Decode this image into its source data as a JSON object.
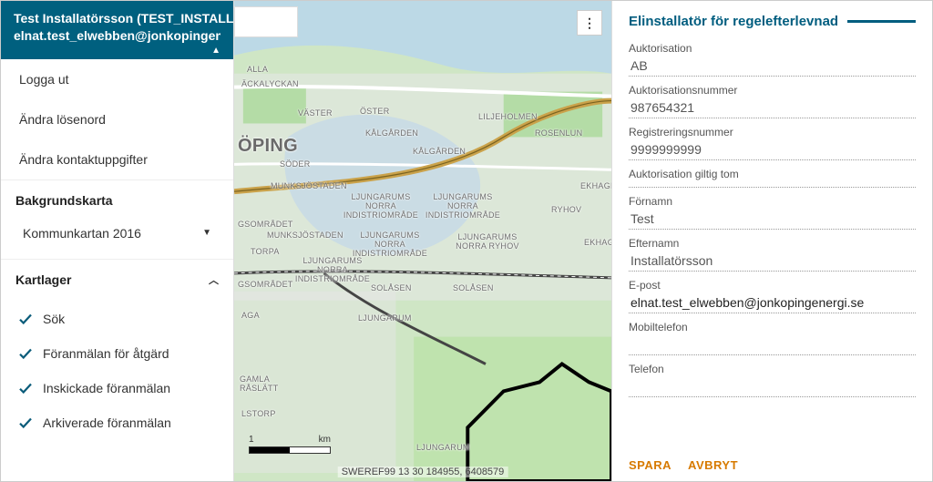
{
  "sidebar": {
    "user_name": "Test Installatörsson (TEST_INSTALLER)",
    "user_email": "elnat.test_elwebben@jonkopingenergi",
    "menu": {
      "logout": "Logga ut",
      "change_password": "Ändra lösenord",
      "change_contact": "Ändra kontaktuppgifter"
    },
    "basemap_title": "Bakgrundskarta",
    "basemap_selected": "Kommunkartan 2016",
    "layers_title": "Kartlager",
    "layers": [
      {
        "label": "Sök"
      },
      {
        "label": "Föranmälan för åtgärd"
      },
      {
        "label": "Inskickade föranmälan"
      },
      {
        "label": "Arkiverade föranmälan"
      }
    ]
  },
  "map": {
    "city_label": "ÖPING",
    "scale_label": "km",
    "scale_value": "1",
    "footer": "SWEREF99 13 30 184955, 6408579",
    "districts": [
      "ALLA",
      "ÄCKALYCKAN",
      "VÄSTER",
      "ÖSTER",
      "KÅLGÅRDEN",
      "LILJEHOLMEN",
      "ROSENLUN",
      "KÅLGÅRDEN",
      "SÖDER",
      "MUNKSJÖSTADEN",
      "LJUNGARUMS NORRA INDISTRIOMRÅDE",
      "LJUNGARUMS NORRA INDISTRIOMRÅDE",
      "RYHOV",
      "EKHAGE",
      "GSOMRÅDET",
      "MUNKSJÖSTADEN",
      "LJUNGARUMS NORRA INDISTRIOMRÅDE",
      "LJUNGARUMS NORRA RYHOV",
      "EKHAG",
      "TORPA",
      "LJUNGARUMS NORRA INDISTRIOMRÅDE",
      "GSOMRÅDET",
      "SOLÅSEN",
      "SOLÅSEN",
      "AGA",
      "LJUNGARUM",
      "GAMLA RÅSLÄTT",
      "LSTORP",
      "LJUNGARUM"
    ]
  },
  "panel": {
    "title": "Elinstallatör för regelefterlevnad",
    "fields": {
      "auth_label": "Auktorisation",
      "auth_value": "AB",
      "authnum_label": "Auktorisationsnummer",
      "authnum_value": "987654321",
      "regnum_label": "Registreringsnummer",
      "regnum_value": "9999999999",
      "valid_label": "Auktorisation giltig tom",
      "valid_value": "",
      "firstname_label": "Förnamn",
      "firstname_value": "Test",
      "lastname_label": "Efternamn",
      "lastname_value": "Installatörsson",
      "email_label": "E-post",
      "email_value": "elnat.test_elwebben@jonkopingenergi.se",
      "mobile_label": "Mobiltelefon",
      "mobile_value": "",
      "phone_label": "Telefon",
      "phone_value": ""
    },
    "save": "SPARA",
    "cancel": "AVBRYT"
  }
}
